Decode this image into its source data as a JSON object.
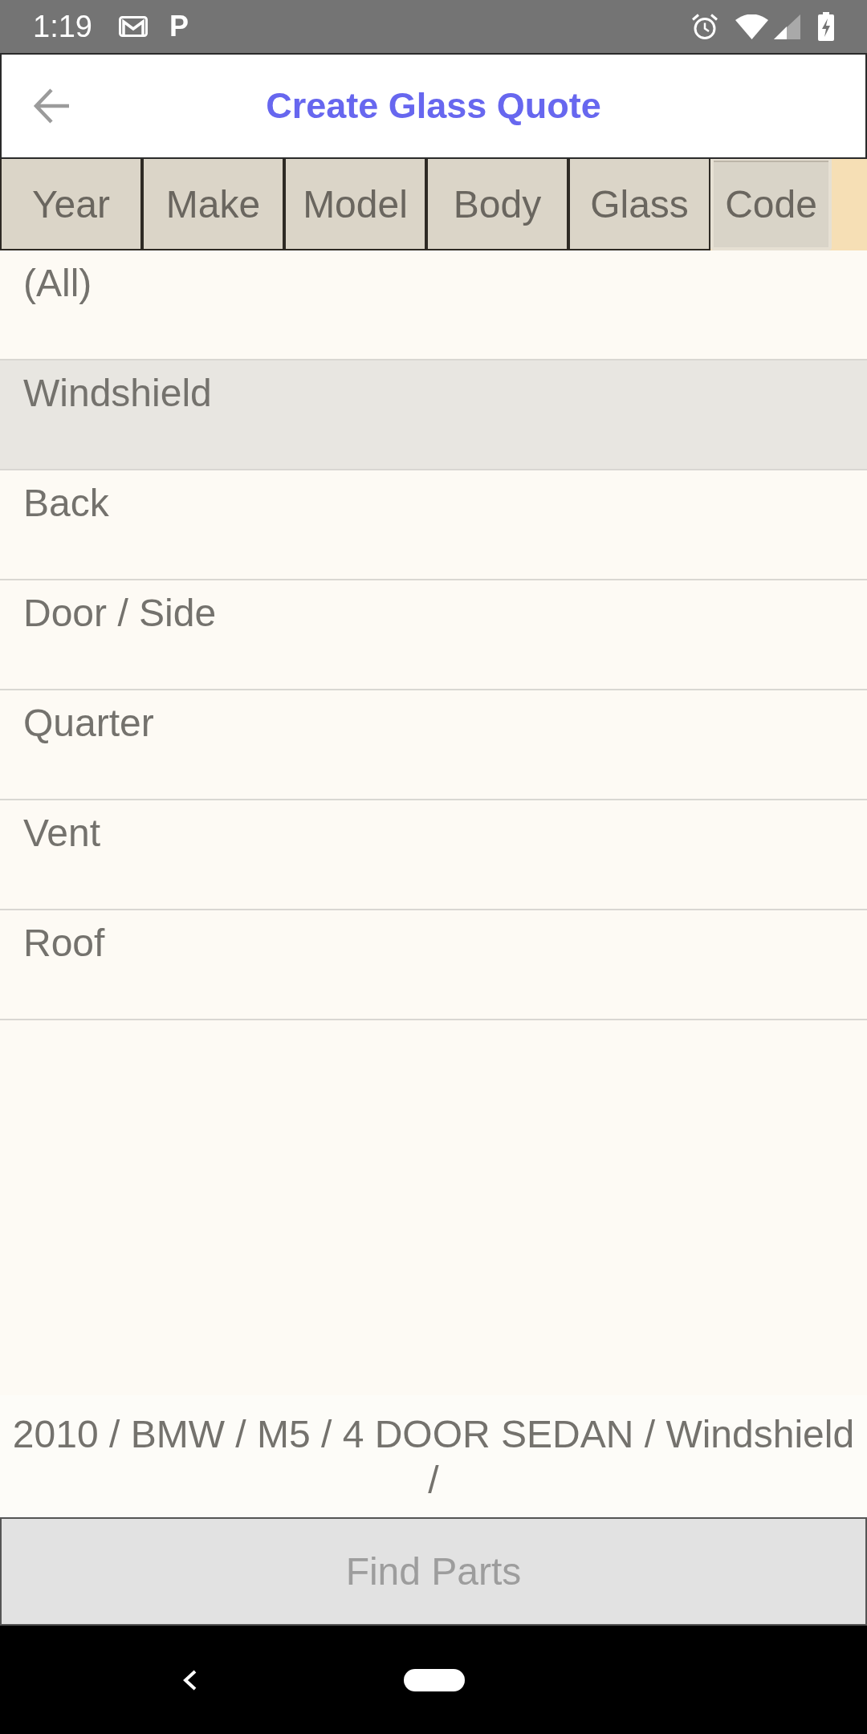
{
  "status_bar": {
    "time": "1:19",
    "notification_letter": "P"
  },
  "header": {
    "title": "Create Glass Quote"
  },
  "tabs": [
    {
      "label": "Year",
      "selected": false
    },
    {
      "label": "Make",
      "selected": false
    },
    {
      "label": "Model",
      "selected": false
    },
    {
      "label": "Body",
      "selected": false
    },
    {
      "label": "Glass",
      "selected": false
    },
    {
      "label": "Code",
      "selected": true
    }
  ],
  "list": {
    "items": [
      {
        "label": "(All)",
        "selected": false
      },
      {
        "label": "Windshield",
        "selected": true
      },
      {
        "label": "Back",
        "selected": false
      },
      {
        "label": "Door / Side",
        "selected": false
      },
      {
        "label": "Quarter",
        "selected": false
      },
      {
        "label": "Vent",
        "selected": false
      },
      {
        "label": "Roof",
        "selected": false
      }
    ]
  },
  "summary": "2010 / BMW / M5 / 4 DOOR SEDAN / Windshield /",
  "find_button": {
    "label": "Find Parts",
    "disabled": true
  }
}
